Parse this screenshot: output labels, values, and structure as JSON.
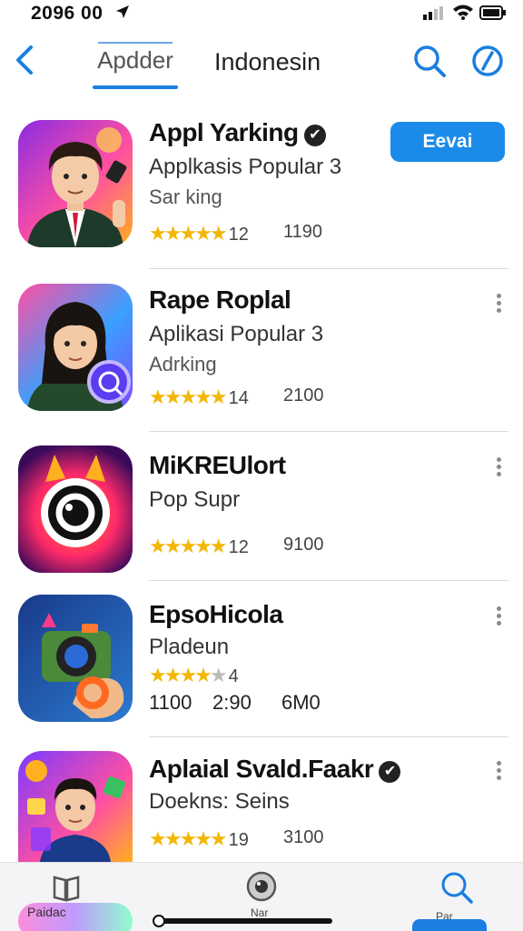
{
  "status_bar": {
    "time": "2096 00"
  },
  "nav": {
    "active_tab": "Apdder",
    "second_tab": "Indonesin"
  },
  "apps": [
    {
      "title": "Appl Yarking",
      "verified": true,
      "subtitle": "Applkasis Popular 3",
      "category": "Sar king",
      "stars": 4.5,
      "rating": "12",
      "count": "1190",
      "action": "Eevai"
    },
    {
      "title": "Rape Roplal",
      "subtitle": "Aplikasi Popular 3",
      "category": "Adrking",
      "stars": 4.5,
      "rating": "14",
      "count": "2100"
    },
    {
      "title": "MiKREUlort",
      "subtitle": "Pop Supr",
      "stars": 4.5,
      "rating": "12",
      "count": "9100"
    },
    {
      "title": "EpsoHicola",
      "subtitle": "Pladeun",
      "stars": 4,
      "rating": "4",
      "stats": [
        "1100",
        "2:90",
        "6M0"
      ]
    },
    {
      "title": "Aplaial Svald.Faakr",
      "verified": true,
      "subtitle": "Doekns: Seins",
      "stars": 4.5,
      "rating": "19",
      "count": "3100"
    }
  ],
  "tab_bar": {
    "labels": [
      "Paidac",
      "Nar",
      "Par"
    ]
  },
  "colors": {
    "accent": "#1a8be8",
    "star": "#f2b705"
  }
}
